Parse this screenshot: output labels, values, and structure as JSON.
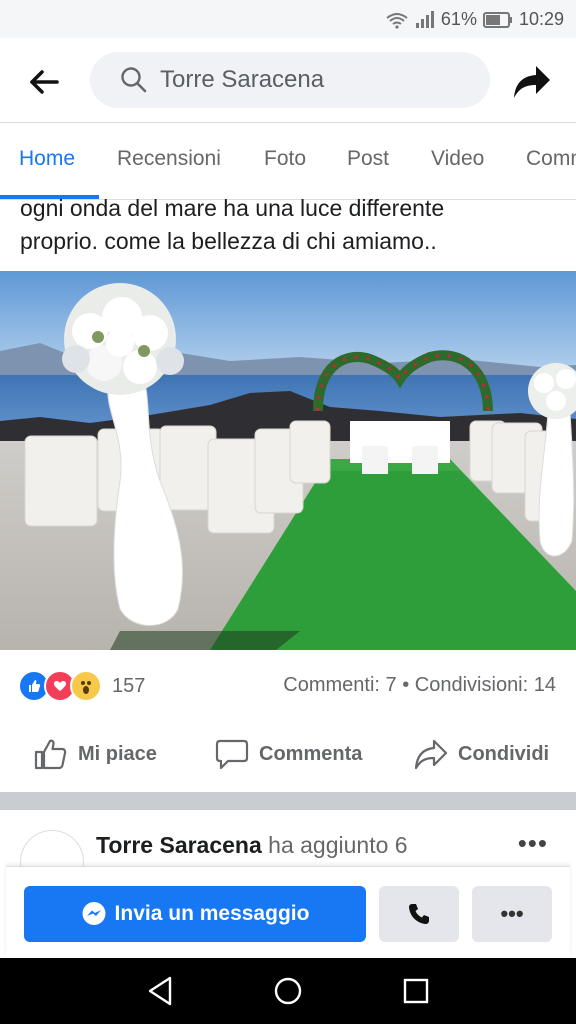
{
  "status_bar": {
    "battery": "61%",
    "time": "10:29"
  },
  "header": {
    "search_value": "Torre Saracena"
  },
  "tabs": [
    {
      "label": "Home",
      "active": true
    },
    {
      "label": "Recensioni"
    },
    {
      "label": "Foto"
    },
    {
      "label": "Post"
    },
    {
      "label": "Video"
    },
    {
      "label": "Comm"
    }
  ],
  "post": {
    "text_line1": "ogni onda del mare ha una luce differente",
    "text_line2": "proprio. come la bellezza di chi amiamo..",
    "reaction_count": "157",
    "comments": "Commenti: 7",
    "separator": "•",
    "shares": "Condivisioni: 14",
    "actions": {
      "like": "Mi piace",
      "comment": "Commenta",
      "share": "Condividi"
    }
  },
  "next_post": {
    "page_name": "Torre Saracena",
    "action": "ha aggiunto 6"
  },
  "bottom_bar": {
    "message_label": "Invia un messaggio",
    "more_label": "•••"
  },
  "colors": {
    "accent": "#1877f2",
    "love": "#f33e58",
    "wow": "#f7c94b",
    "carpet": "#2e9e3a"
  },
  "icons": [
    "wifi-icon",
    "signal-icon",
    "battery-icon",
    "back-arrow-icon",
    "search-icon",
    "share-arrow-icon",
    "like-icon",
    "love-icon",
    "wow-icon",
    "thumbs-up-icon",
    "comment-icon",
    "share-icon",
    "messenger-icon",
    "phone-icon",
    "back-triangle-icon",
    "home-circle-icon",
    "recents-square-icon"
  ]
}
